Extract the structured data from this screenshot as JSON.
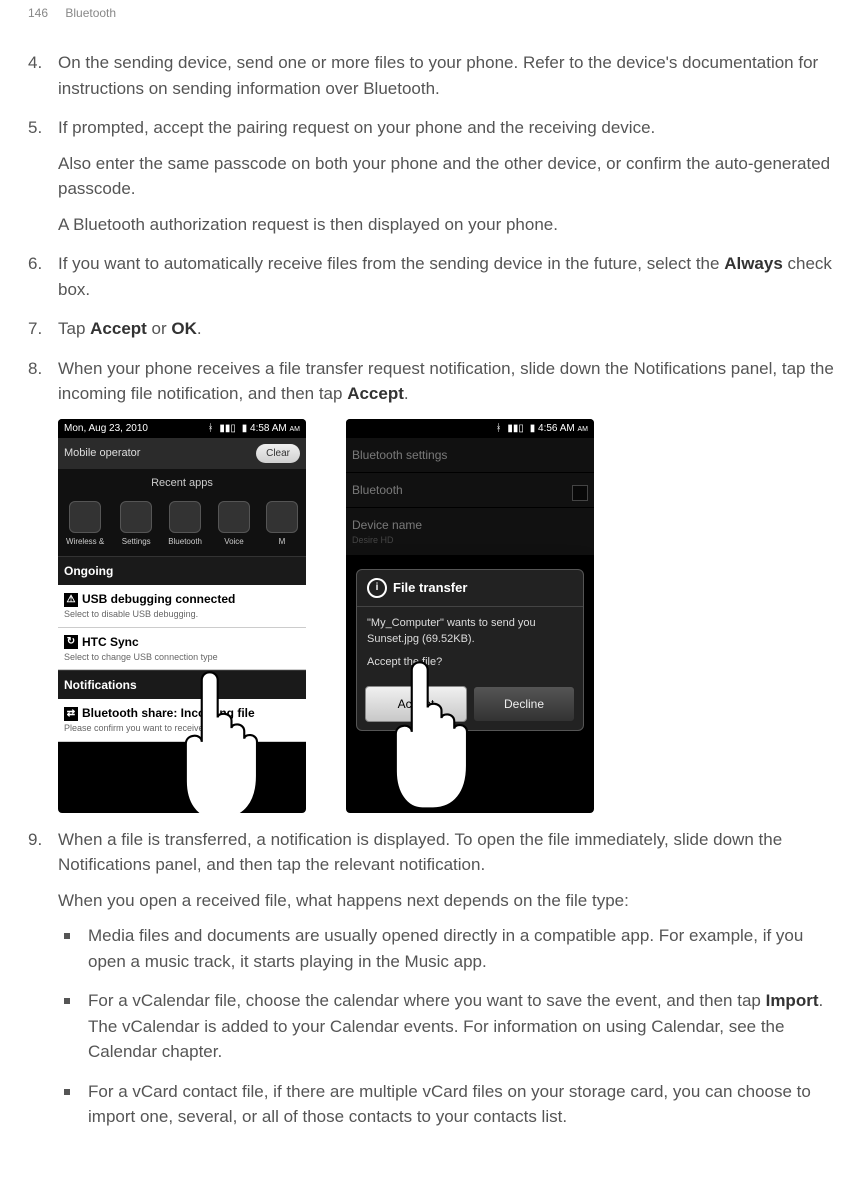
{
  "header": {
    "page_number": "146",
    "section": "Bluetooth"
  },
  "steps": {
    "s4": {
      "text": "On the sending device, send one or more files to your phone. Refer to the device's documentation for instructions on sending information over Bluetooth."
    },
    "s5": {
      "text": "If prompted, accept the pairing request on your phone and the receiving device.",
      "p2": "Also enter the same passcode on both your phone and the other device, or confirm the auto-generated passcode.",
      "p3": "A Bluetooth authorization request is then displayed on your phone."
    },
    "s6": {
      "pre": "If you want to automatically receive files from the sending device in the future, select the ",
      "bold": "Always",
      "post": " check box."
    },
    "s7": {
      "pre": "Tap ",
      "b1": "Accept",
      "mid": " or ",
      "b2": "OK",
      "post": "."
    },
    "s8": {
      "pre": "When your phone receives a file transfer request notification, slide down the Notifications panel, tap the incoming file notification, and then tap ",
      "bold": "Accept",
      "post": "."
    },
    "s9": {
      "text": "When a file is transferred, a notification is displayed. To open the file immediately, slide down the Notifications panel, and then tap the relevant notification.",
      "p2": "When you open a received file, what happens next depends on the file type:",
      "bullets": {
        "b1": "Media files and documents are usually opened directly in a compatible app. For example, if you open a music track, it starts playing in the Music app.",
        "b2": {
          "pre": "For a vCalendar file, choose the calendar where you want to save the event, and then tap ",
          "bold": "Import",
          "post": ". The vCalendar is added to your Calendar events. For information on using Calendar, see the Calendar chapter."
        },
        "b3": "For a vCard contact file, if there are multiple vCard files on your storage card, you can choose to import one, several, or all of those contacts to your contacts list."
      }
    }
  },
  "shot1": {
    "date": "Mon, Aug 23, 2010",
    "time": "4:58 AM",
    "operator": "Mobile operator",
    "clear": "Clear",
    "recent": "Recent apps",
    "apps": [
      "Wireless &",
      "Settings",
      "Bluetooth",
      "Voice",
      "M"
    ],
    "ongoing": "Ongoing",
    "usb_t": "USB debugging connected",
    "usb_s": "Select to disable USB debugging.",
    "sync_t": "HTC Sync",
    "sync_s": "Select to change USB connection type",
    "notif": "Notifications",
    "bt_t": "Bluetooth share: Incoming file",
    "bt_s": "Please confirm you want to receive this file"
  },
  "shot2": {
    "time": "4:56 AM",
    "settings": "Bluetooth settings",
    "bt": "Bluetooth",
    "devname": "Device name",
    "devval": "Desire HD",
    "dlg_title": "File transfer",
    "dlg_body1": "\"My_Computer\" wants to send you Sunset.jpg (69.52KB).",
    "dlg_body2": "Accept the file?",
    "accept": "Accept",
    "decline": "Decline"
  }
}
